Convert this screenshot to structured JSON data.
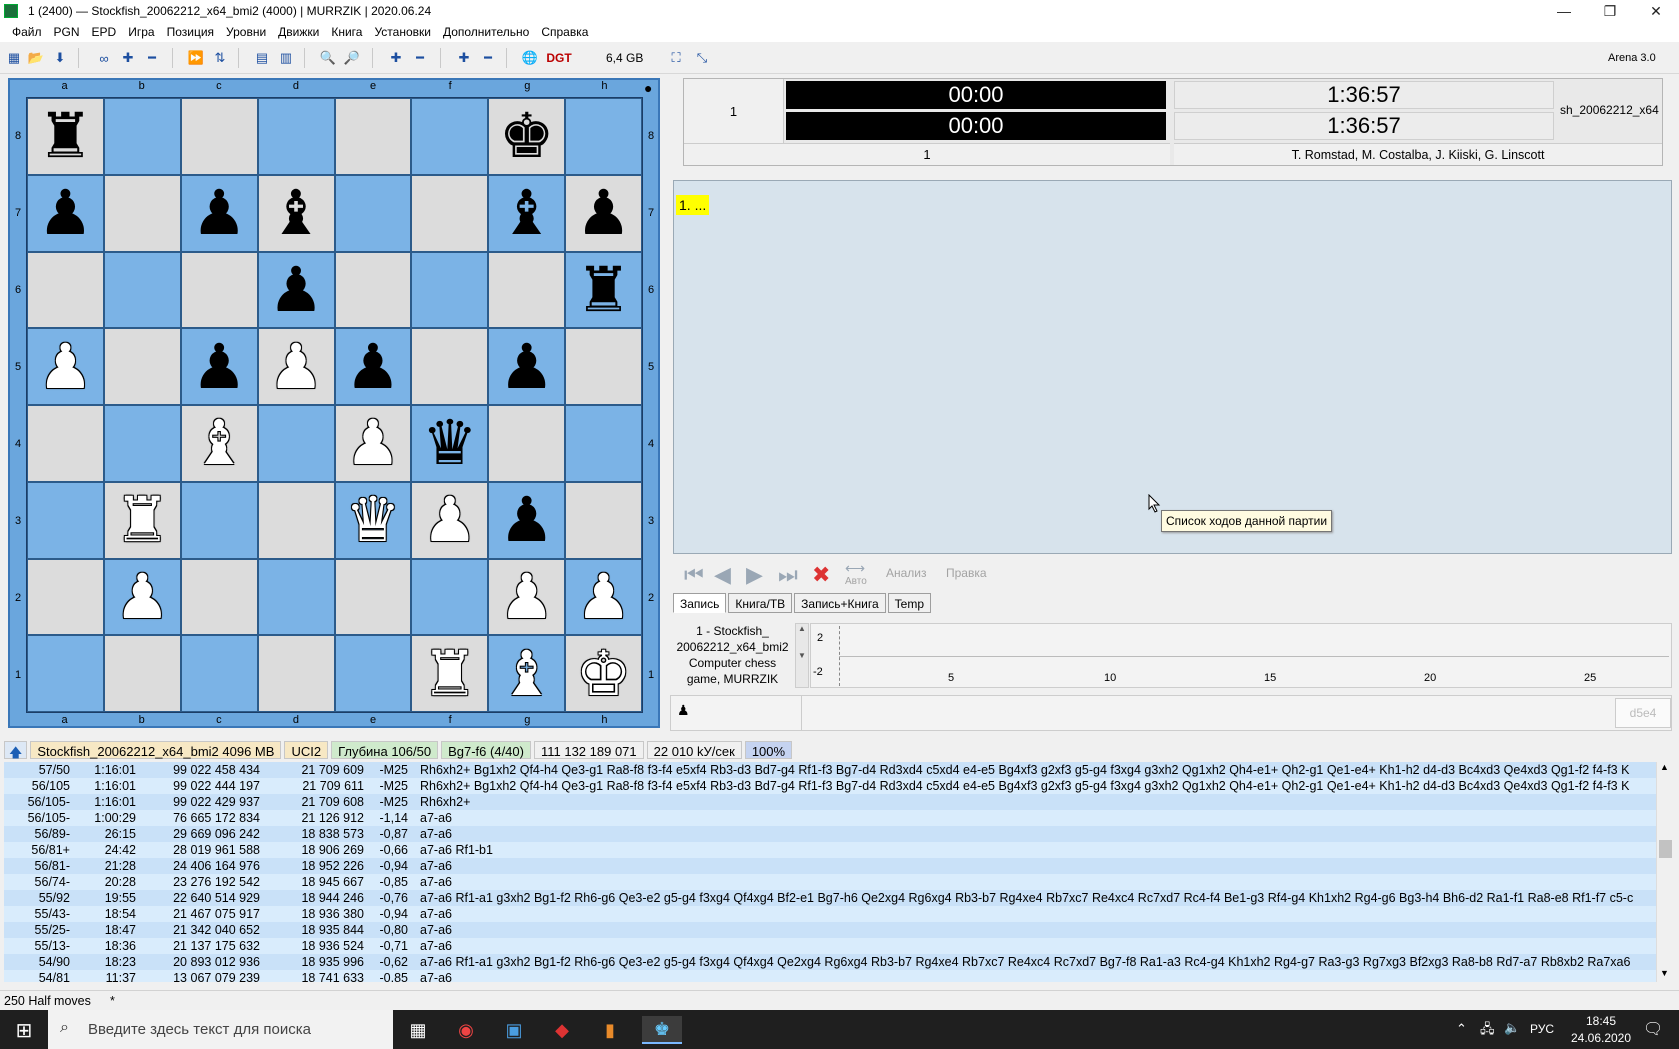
{
  "window": {
    "title": "1 (2400)  —  Stockfish_20062212_x64_bmi2 (4000)   |   MURRZIK   |   2020.06.24",
    "minimize": "—",
    "maximize": "❐",
    "close": "✕"
  },
  "menu": [
    "Файл",
    "PGN",
    "EPD",
    "Игра",
    "Позиция",
    "Уровни",
    "Движки",
    "Книга",
    "Установки",
    "Дополнительно",
    "Справка"
  ],
  "toolbar": {
    "memory": "6,4 GB",
    "app_version": "Arena 3.0"
  },
  "board": {
    "files": [
      "a",
      "b",
      "c",
      "d",
      "e",
      "f",
      "g",
      "h"
    ],
    "ranks": [
      "8",
      "7",
      "6",
      "5",
      "4",
      "3",
      "2",
      "1"
    ],
    "position": [
      [
        "br",
        "",
        "",
        "",
        "",
        "",
        "bk",
        ""
      ],
      [
        "bp",
        "",
        "bp",
        "bb",
        "",
        "",
        "bb",
        "bp"
      ],
      [
        "",
        "",
        "",
        "bp",
        "",
        "",
        "",
        "br"
      ],
      [
        "wp",
        "",
        "bp",
        "wp",
        "bp",
        "",
        "bp",
        ""
      ],
      [
        "",
        "",
        "wb",
        "",
        "wp",
        "bq",
        "",
        ""
      ],
      [
        "",
        "wr",
        "",
        "",
        "wq",
        "wp",
        "bp",
        ""
      ],
      [
        "",
        "wp",
        "",
        "",
        "",
        "",
        "wp",
        "wp"
      ],
      [
        "",
        "",
        "",
        "",
        "",
        "wr",
        "wb",
        "wk"
      ]
    ],
    "glyphs": {
      "k": "♚",
      "q": "♛",
      "r": "♜",
      "b": "♝",
      "n": "♞",
      "p": "♟"
    },
    "side_to_move": "●"
  },
  "clocks": {
    "game_no": "1",
    "white_time": "00:00",
    "black_time": "00:00",
    "white_remaining": "1:36:57",
    "black_remaining": "1:36:57",
    "engine_short": "sh_20062212_x64",
    "round": "1",
    "authors": "T. Romstad, M. Costalba, J. Kiiski, G. Linscott"
  },
  "notation": {
    "move_text": "1. ...",
    "tooltip": "Список ходов данной партии",
    "btn_auto": "Авто",
    "btn_analysis": "Анализ",
    "btn_edit": "Правка"
  },
  "tabs": [
    "Запись",
    "Книга/ТВ",
    "Запись+Книга",
    "Temp"
  ],
  "gameinfo": {
    "l1": "1 - Stockfish_",
    "l2": "20062212_x64_bmi2",
    "l3": "Computer chess",
    "l4": "game, MURRZIK"
  },
  "graph": {
    "y_top": "2",
    "y_bottom": "-2",
    "ticks": [
      "5",
      "10",
      "15",
      "20",
      "25"
    ]
  },
  "pawnrow": {
    "last_move": "d5e4"
  },
  "engine": {
    "name": "Stockfish_20062212_x64_bmi2  4096 MB",
    "protocol": "UCI2",
    "depth": "Глубина 106/50",
    "current": "Bg7-f6 (4/40)",
    "nodes": "111 132 189 071",
    "speed": "22 010 kУ/сек",
    "hash": "100%"
  },
  "analysis": [
    {
      "d": "57/50",
      "t": "1:16:01",
      "n": "99 022 458 434",
      "nps": "21 709 609",
      "s": "-M25",
      "pv": "Rh6xh2+ Bg1xh2 Qf4-h4 Qe3-g1 Ra8-f8 f3-f4 e5xf4 Rb3-d3 Bd7-g4 Rf1-f3 Bg7-d4 Rd3xd4 c5xd4 e4-e5 Bg4xf3 g2xf3 g5-g4 f3xg4 g3xh2 Qg1xh2 Qh4-e1+ Qh2-g1 Qe1-e4+ Kh1-h2 d4-d3 Bc4xd3 Qe4xd3 Qg1-f2 f4-f3 K"
    },
    {
      "d": "56/105",
      "t": "1:16:01",
      "n": "99 022 444 197",
      "nps": "21 709 611",
      "s": "-M25",
      "pv": "Rh6xh2+ Bg1xh2 Qf4-h4 Qe3-g1 Ra8-f8 f3-f4 e5xf4 Rb3-d3 Bd7-g4 Rf1-f3 Bg7-d4 Rd3xd4 c5xd4 e4-e5 Bg4xf3 g2xf3 g5-g4 f3xg4 g3xh2 Qg1xh2 Qh4-e1+ Qh2-g1 Qe1-e4+ Kh1-h2 d4-d3 Bc4xd3 Qe4xd3 Qg1-f2 f4-f3 K"
    },
    {
      "d": "56/105-",
      "t": "1:16:01",
      "n": "99 022 429 937",
      "nps": "21 709 608",
      "s": "-M25",
      "pv": "Rh6xh2+"
    },
    {
      "d": "56/105-",
      "t": "1:00:29",
      "n": "76 665 172 834",
      "nps": "21 126 912",
      "s": "-1,14",
      "pv": "a7-a6"
    },
    {
      "d": "56/89-",
      "t": "26:15",
      "n": "29 669 096 242",
      "nps": "18 838 573",
      "s": "-0,87",
      "pv": "a7-a6"
    },
    {
      "d": "56/81+",
      "t": "24:42",
      "n": "28 019 961 588",
      "nps": "18 906 269",
      "s": "-0,66",
      "pv": "a7-a6 Rf1-b1"
    },
    {
      "d": "56/81-",
      "t": "21:28",
      "n": "24 406 164 976",
      "nps": "18 952 226",
      "s": "-0,94",
      "pv": "a7-a6"
    },
    {
      "d": "56/74-",
      "t": "20:28",
      "n": "23 276 192 542",
      "nps": "18 945 667",
      "s": "-0,85",
      "pv": "a7-a6"
    },
    {
      "d": "55/92",
      "t": "19:55",
      "n": "22 640 514 929",
      "nps": "18 944 246",
      "s": "-0,76",
      "pv": "a7-a6 Rf1-a1 g3xh2 Bg1-f2 Rh6-g6 Qe3-e2 g5-g4 f3xg4 Qf4xg4 Bf2-e1 Bg7-h6 Qe2xg4 Rg6xg4 Rb3-b7 Rg4xe4 Rb7xc7 Re4xc4 Rc7xd7 Rc4-f4 Be1-g3 Rf4-g4 Kh1xh2 Rg4-g6 Bg3-h4 Bh6-d2 Ra1-f1 Ra8-e8 Rf1-f7 c5-c"
    },
    {
      "d": "55/43-",
      "t": "18:54",
      "n": "21 467 075 917",
      "nps": "18 936 380",
      "s": "-0,94",
      "pv": "a7-a6"
    },
    {
      "d": "55/25-",
      "t": "18:47",
      "n": "21 342 040 652",
      "nps": "18 935 844",
      "s": "-0,80",
      "pv": "a7-a6"
    },
    {
      "d": "55/13-",
      "t": "18:36",
      "n": "21 137 175 632",
      "nps": "18 936 524",
      "s": "-0,71",
      "pv": "a7-a6"
    },
    {
      "d": "54/90",
      "t": "18:23",
      "n": "20 893 012 936",
      "nps": "18 935 996",
      "s": "-0,62",
      "pv": "a7-a6 Rf1-a1 g3xh2 Bg1-f2 Rh6-g6 Qe3-e2 g5-g4 f3xg4 Qf4xg4 Qe2xg4 Rg6xg4 Rb3-b7 Rg4xe4 Rb7xc7 Re4xc4 Rc7xd7 Bg7-f8 Ra1-a3 Rc4-g4 Kh1xh2 Rg4-g7 Ra3-g3 Rg7xg3 Bf2xg3 Ra8-b8 Rd7-a7 Rb8xb2 Ra7xa6"
    },
    {
      "d": "54/81",
      "t": "11:37",
      "n": "13 067 079 239",
      "nps": "18 741 633",
      "s": "-0,85",
      "pv": "a7-a6"
    }
  ],
  "status": {
    "halfmoves": "250 Half moves",
    "mod": "*"
  },
  "taskbar": {
    "search_placeholder": "Введите здесь текст для поиска",
    "lang": "РУС",
    "time": "18:45",
    "date": "24.06.2020"
  }
}
